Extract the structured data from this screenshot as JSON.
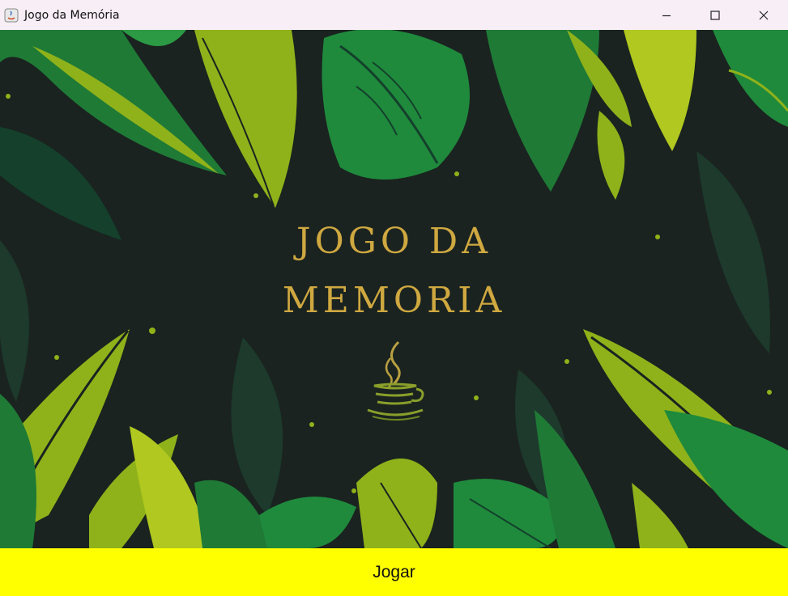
{
  "window": {
    "title": "Jogo da Memória",
    "icon": "java-app-icon",
    "controls": [
      "minimize-icon",
      "maximize-icon",
      "close-icon"
    ]
  },
  "main": {
    "title_line1": "JOGO DA",
    "title_line2": "MEMORIA",
    "logo": "java-coffee-cup-icon",
    "background": "tropical-leaves-illustration"
  },
  "play_button": {
    "label": "Jogar"
  },
  "colors": {
    "titlebar_bg": "#f8eef6",
    "background": "#1a2320",
    "title_gold": "#cfa840",
    "button_bg": "#ffff00",
    "leaf_dark": "#14402c",
    "leaf_green": "#1e8a3c",
    "leaf_lime": "#8fb21a"
  }
}
